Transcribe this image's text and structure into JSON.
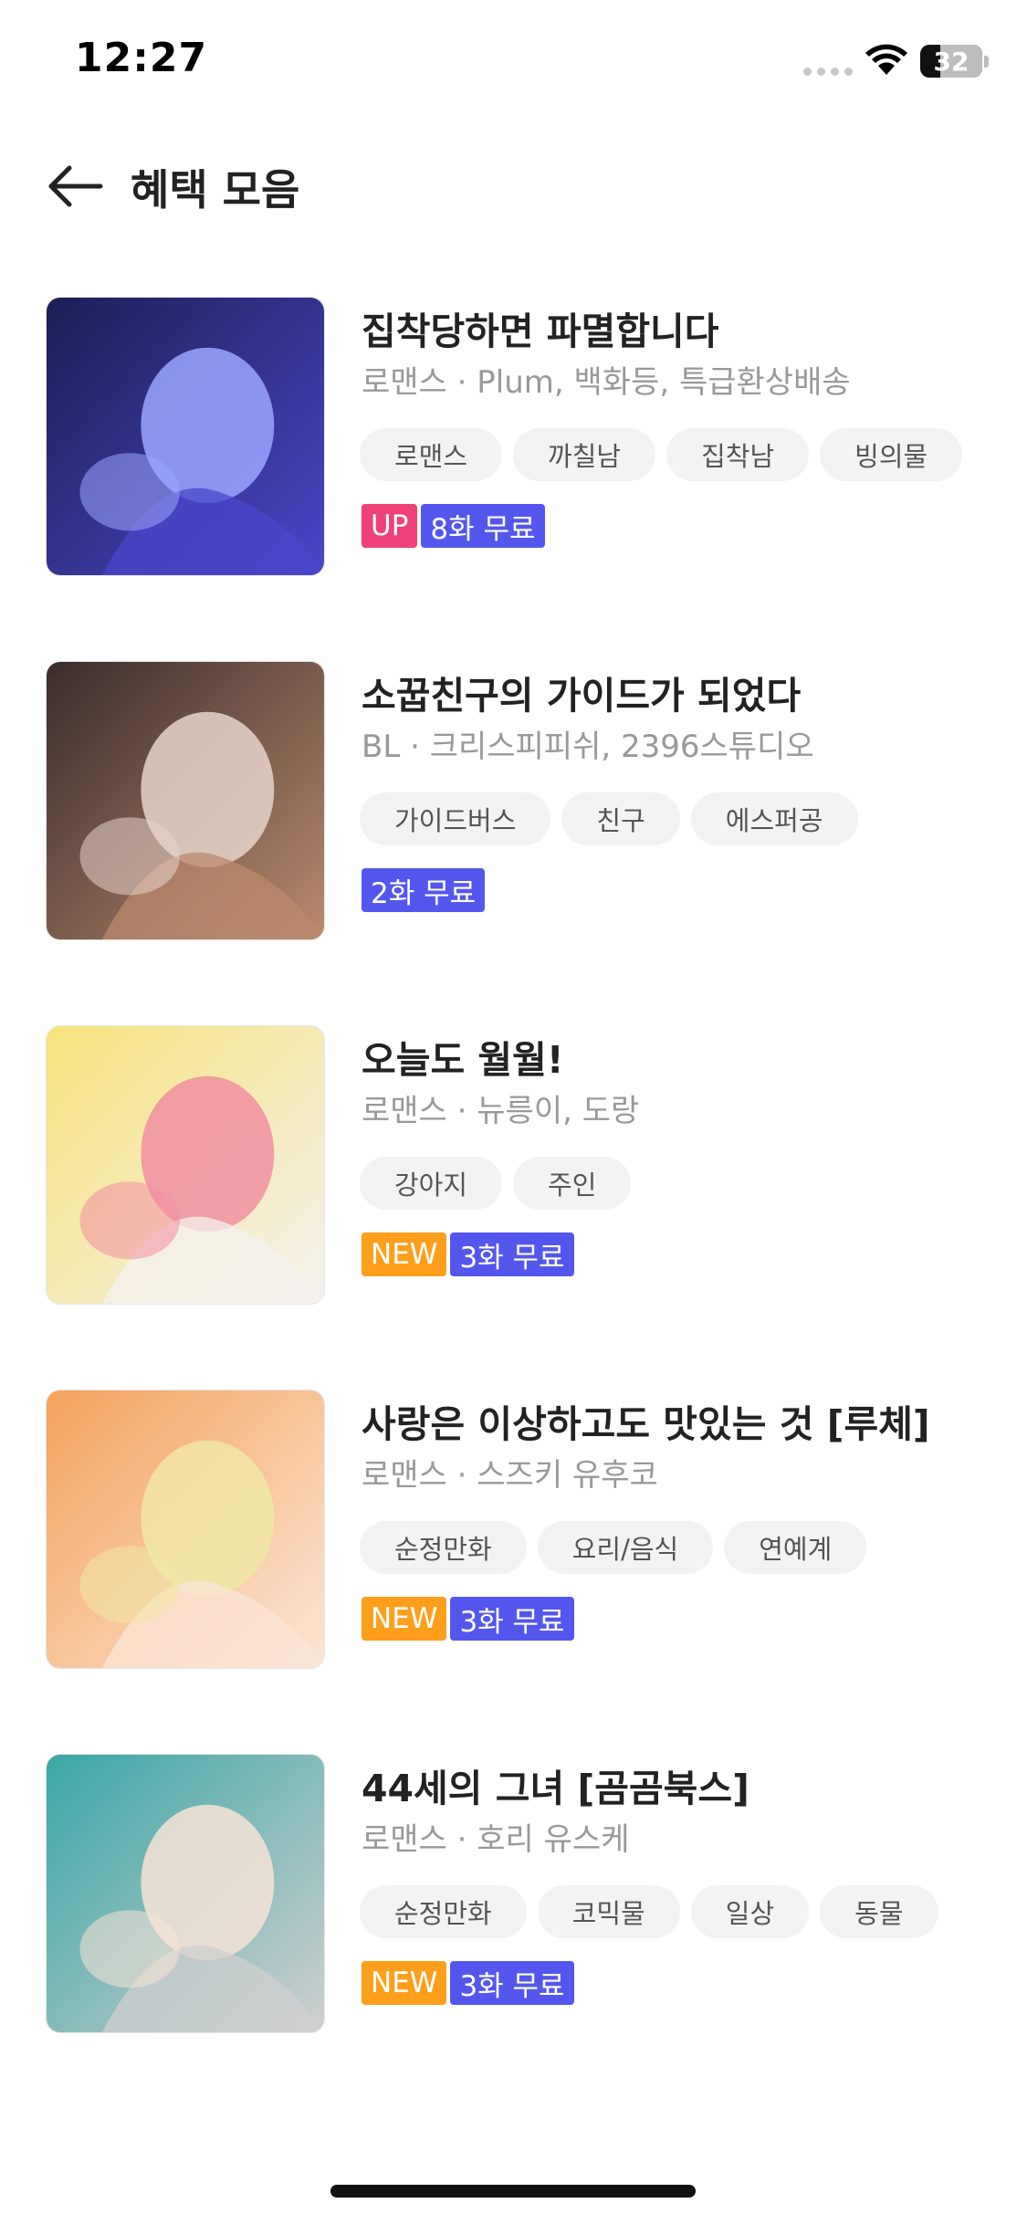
{
  "status_bar": {
    "time": "12:27",
    "battery_level": "32"
  },
  "header": {
    "title": "혜택 모음",
    "back_icon": "arrow-left-icon"
  },
  "comics": [
    {
      "title": "집착당하면 파멸합니다",
      "meta": "로맨스 · Plum, 백화등, 특급환상배송",
      "tags": [
        "로맨스",
        "까칠남",
        "집착남",
        "빙의물"
      ],
      "badges": [
        {
          "label": "UP",
          "color": "#f0407a"
        },
        {
          "label": "8화 무료",
          "color": "#5457ee"
        }
      ],
      "thumb_palette": [
        "#1c1f55",
        "#4a47c9",
        "#9aa6ff"
      ]
    },
    {
      "title": "소꿉친구의 가이드가 되었다",
      "meta": "BL · 크리스피피쉬, 2396스튜디오",
      "tags": [
        "가이드버스",
        "친구",
        "에스퍼공"
      ],
      "badges": [
        {
          "label": "2화 무료",
          "color": "#5457ee"
        }
      ],
      "thumb_palette": [
        "#3a2c2c",
        "#b98a6c",
        "#e8d4c9"
      ]
    },
    {
      "title": "오늘도 월월!",
      "meta": "로맨스 · 뉴릉이, 도랑",
      "tags": [
        "강아지",
        "주인"
      ],
      "badges": [
        {
          "label": "NEW",
          "color": "#ff9f1c"
        },
        {
          "label": "3화 무료",
          "color": "#5457ee"
        }
      ],
      "thumb_palette": [
        "#f7e37c",
        "#f4f1ee",
        "#f08fa0"
      ]
    },
    {
      "title": "사랑은 이상하고도 맛있는 것 [루체]",
      "meta": "로맨스 · 스즈키 유후코",
      "tags": [
        "순정만화",
        "요리/음식",
        "연예계"
      ],
      "badges": [
        {
          "label": "NEW",
          "color": "#ff9f1c"
        },
        {
          "label": "3화 무료",
          "color": "#5457ee"
        }
      ],
      "thumb_palette": [
        "#f3a25c",
        "#fbe6d6",
        "#f0e6a6"
      ]
    },
    {
      "title": "44세의 그녀 [곰곰북스]",
      "meta": "로맨스 · 호리 유스케",
      "tags": [
        "순정만화",
        "코믹물",
        "일상",
        "동물"
      ],
      "badges": [
        {
          "label": "NEW",
          "color": "#ff9f1c"
        },
        {
          "label": "3화 무료",
          "color": "#5457ee"
        }
      ],
      "thumb_palette": [
        "#3aa6a6",
        "#cfcfcf",
        "#f6e3d6"
      ]
    }
  ]
}
